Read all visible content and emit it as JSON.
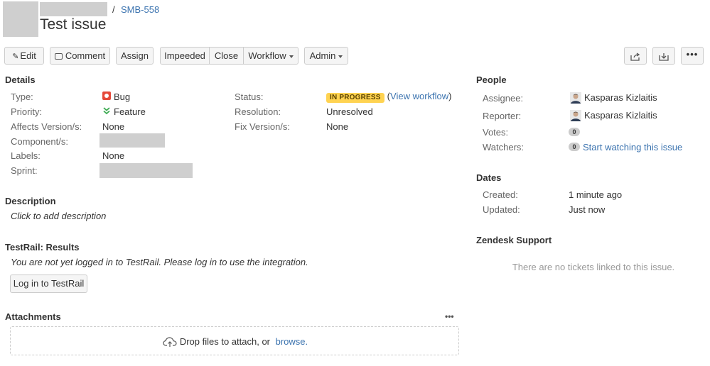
{
  "header": {
    "issue_key": "SMB-558",
    "separator": "/",
    "title": "Test issue"
  },
  "toolbar": {
    "edit_label": "Edit",
    "comment_label": "Comment",
    "assign_label": "Assign",
    "impeeded_label": "Impeeded",
    "close_label": "Close",
    "workflow_label": "Workflow",
    "admin_label": "Admin"
  },
  "details": {
    "heading": "Details",
    "type_label": "Type:",
    "type_value": "Bug",
    "priority_label": "Priority:",
    "priority_value": "Feature",
    "affects_label": "Affects Version/s:",
    "affects_value": "None",
    "component_label": "Component/s:",
    "labels_label": "Labels:",
    "labels_value": "None",
    "sprint_label": "Sprint:",
    "status_label": "Status:",
    "status_value": "IN PROGRESS",
    "view_workflow_open": "(",
    "view_workflow_link": "View workflow",
    "view_workflow_close": ")",
    "resolution_label": "Resolution:",
    "resolution_value": "Unresolved",
    "fix_label": "Fix Version/s:",
    "fix_value": "None"
  },
  "description": {
    "heading": "Description",
    "placeholder": "Click to add description"
  },
  "testrail": {
    "heading": "TestRail: Results",
    "message": "You are not yet logged in to TestRail. Please log in to use the integration.",
    "login_label": "Log in to TestRail"
  },
  "attachments": {
    "heading": "Attachments",
    "drop_text": "Drop files to attach, or",
    "browse_link": "browse."
  },
  "people": {
    "heading": "People",
    "assignee_label": "Assignee:",
    "assignee_value": "Kasparas Kizlaitis",
    "reporter_label": "Reporter:",
    "reporter_value": "Kasparas Kizlaitis",
    "votes_label": "Votes:",
    "votes_count": "0",
    "watchers_label": "Watchers:",
    "watchers_count": "0",
    "watch_link": "Start watching this issue"
  },
  "dates": {
    "heading": "Dates",
    "created_label": "Created:",
    "created_value": "1 minute ago",
    "updated_label": "Updated:",
    "updated_value": "Just now"
  },
  "zendesk": {
    "heading": "Zendesk Support",
    "empty_text": "There are no tickets linked to this issue."
  },
  "colors": {
    "link": "#3b73af",
    "status_yellow": "#ffd351",
    "bug_red": "#e5493a",
    "priority_green": "#3cab52"
  }
}
